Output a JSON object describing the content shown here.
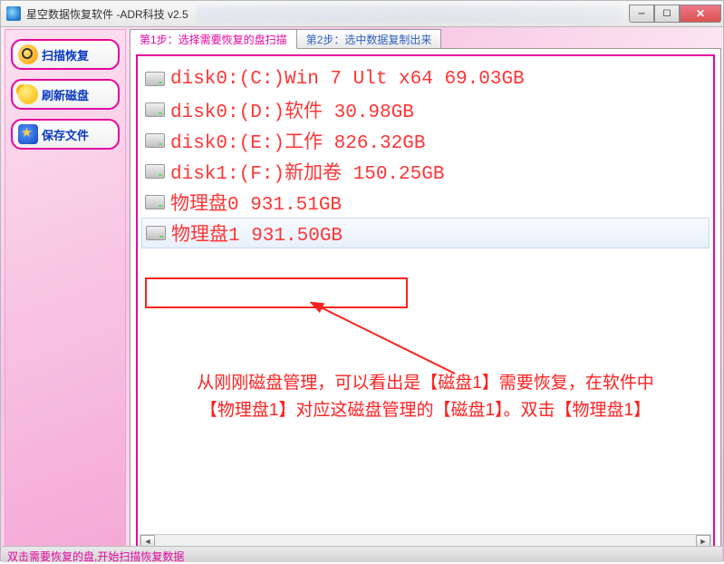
{
  "window": {
    "title": "星空数据恢复软件   -ADR科技 v2.5"
  },
  "sidebar": {
    "buttons": [
      {
        "label": "扫描恢复"
      },
      {
        "label": "刷新磁盘"
      },
      {
        "label": "保存文件"
      }
    ]
  },
  "tabs": {
    "items": [
      {
        "label": "第1步：选择需要恢复的盘扫描",
        "active": true
      },
      {
        "label": "第2步：选中数据复制出来",
        "active": false
      }
    ]
  },
  "disks": [
    {
      "text": "disk0:(C:)Win 7 Ult x64 69.03GB",
      "selected": false
    },
    {
      "text": "disk0:(D:)软件 30.98GB",
      "selected": false
    },
    {
      "text": "disk0:(E:)工作 826.32GB",
      "selected": false
    },
    {
      "text": "disk1:(F:)新加卷 150.25GB",
      "selected": false
    },
    {
      "text": "物理盘0 931.51GB",
      "selected": false
    },
    {
      "text": "物理盘1 931.50GB",
      "selected": true
    }
  ],
  "annotation": {
    "line1": "从刚刚磁盘管理，可以看出是【磁盘1】需要恢复，在软件中",
    "line2": "【物理盘1】对应这磁盘管理的【磁盘1】。双击【物理盘1】"
  },
  "statusbar": {
    "text": "双击需要恢复的盘,开始扫描恢复数据"
  }
}
